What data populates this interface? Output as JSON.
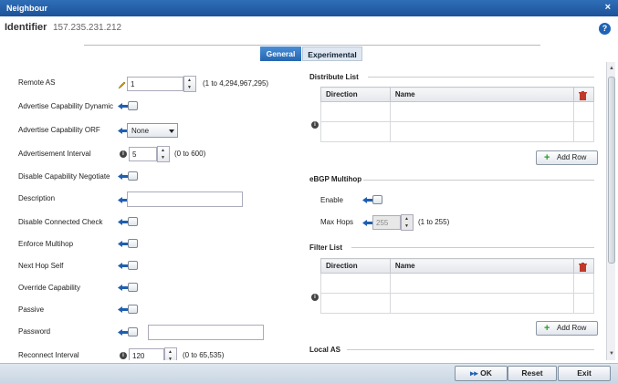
{
  "window": {
    "title": "Neighbour",
    "close": "×"
  },
  "identifier": {
    "label": "Identifier",
    "value": "157.235.231.212"
  },
  "help": "?",
  "tabs": [
    {
      "label": "General",
      "active": true
    },
    {
      "label": "Experimental",
      "active": false
    }
  ],
  "left": {
    "remote_as": {
      "label": "Remote AS",
      "value": "1",
      "hint": "(1 to 4,294,967,295)"
    },
    "adv_cap_dynamic": {
      "label": "Advertise Capability Dynamic"
    },
    "adv_cap_orf": {
      "label": "Advertise Capability ORF",
      "value": "None"
    },
    "adv_interval": {
      "label": "Advertisement Interval",
      "value": "5",
      "hint": "(0 to 600)"
    },
    "disable_cap_neg": {
      "label": "Disable Capability Negotiate"
    },
    "description": {
      "label": "Description",
      "value": ""
    },
    "disable_conn_check": {
      "label": "Disable Connected Check"
    },
    "enforce_multihop": {
      "label": "Enforce Multihop"
    },
    "next_hop_self": {
      "label": "Next Hop Self"
    },
    "override_cap": {
      "label": "Override Capability"
    },
    "passive": {
      "label": "Passive"
    },
    "password": {
      "label": "Password",
      "value": ""
    },
    "reconnect_interval": {
      "label": "Reconnect Interval",
      "value": "120",
      "hint": "(0 to 65,535)"
    }
  },
  "right": {
    "distribute_list": {
      "title": "Distribute List",
      "columns": [
        "Direction",
        "Name"
      ],
      "add_row": "Add Row"
    },
    "ebgp_multihop": {
      "title": "eBGP Multihop",
      "enable_label": "Enable",
      "max_hops_label": "Max Hops",
      "max_hops_value": "255",
      "max_hops_hint": "(1 to 255)"
    },
    "filter_list": {
      "title": "Filter List",
      "columns": [
        "Direction",
        "Name"
      ],
      "add_row": "Add Row"
    },
    "local_as": {
      "title": "Local AS"
    }
  },
  "footer": {
    "ok": "OK",
    "reset": "Reset",
    "exit": "Exit"
  },
  "colors": {
    "titlebar": "#1d5299",
    "accent": "#2466b0",
    "add": "#2c9a2c",
    "delete": "#c0392b"
  }
}
